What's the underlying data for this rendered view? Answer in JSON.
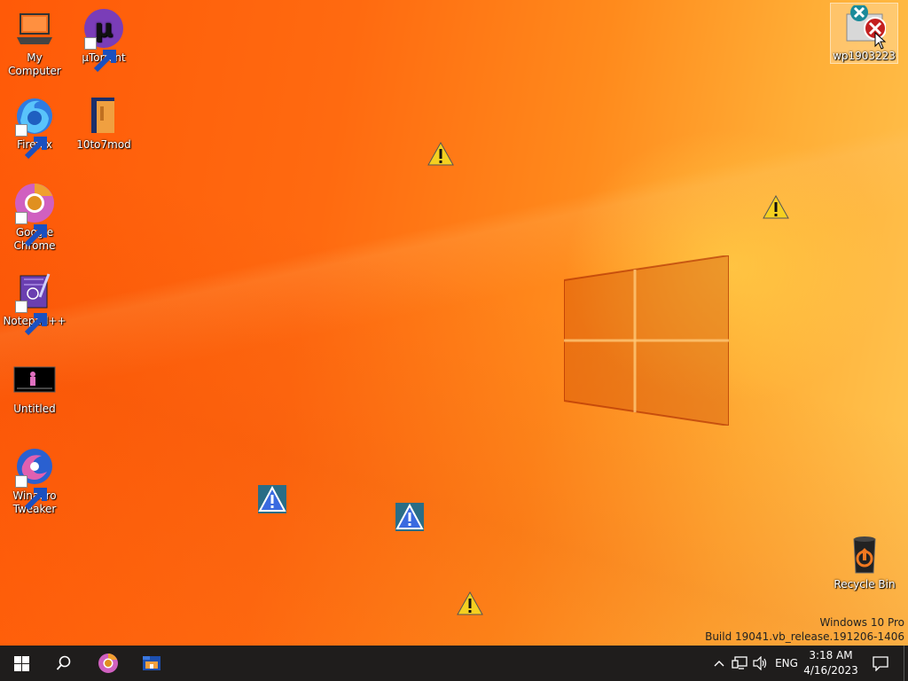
{
  "desktop_icons": [
    {
      "name": "my-computer",
      "label": "My Computer"
    },
    {
      "name": "utorrent",
      "label": "µTorrent"
    },
    {
      "name": "firefox",
      "label": "Firefox"
    },
    {
      "name": "10to7mod",
      "label": "10to7mod"
    },
    {
      "name": "google-chrome",
      "label": "Google Chrome"
    },
    {
      "name": "notepad-plus-plus",
      "label": "Notepad++"
    },
    {
      "name": "untitled",
      "label": "Untitled"
    },
    {
      "name": "winaero-tweaker",
      "label": "Winaero Tweaker"
    },
    {
      "name": "wp1903223",
      "label": "wp1903223"
    },
    {
      "name": "recycle-bin",
      "label": "Recycle Bin"
    }
  ],
  "watermark": {
    "edition": "Windows 10 Pro",
    "build": "Build 19041.vb_release.191206-1406"
  },
  "taskbar": {
    "pinned": [
      "start-icon",
      "search-icon",
      "chrome-icon",
      "file-explorer-icon"
    ],
    "tray": {
      "language": "ENG",
      "time": "3:18 AM",
      "date": "4/16/2023"
    }
  },
  "colors": {
    "taskbar": "#1f1d1c",
    "wallpaper_left": "#ff5a08",
    "wallpaper_right": "#ffc652"
  }
}
